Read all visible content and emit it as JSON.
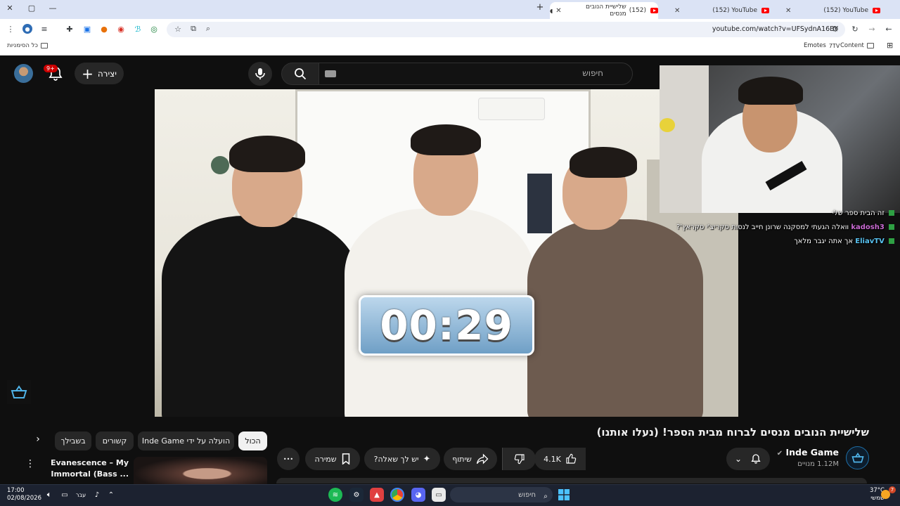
{
  "browser": {
    "tabs": [
      {
        "title": "שלישיית הנובים מנסים",
        "count_prefix": "(152)",
        "active": true
      },
      {
        "title": "(152) YouTube",
        "active": false
      },
      {
        "title": "(152) YouTube",
        "active": false
      }
    ],
    "new_tab": "+",
    "url": "youtube.com/watch?v=UFSydnA16BY",
    "bookmarks": {
      "all_bookmarks": "כל הסימניות",
      "emotes": "Emotes",
      "content": "Content"
    }
  },
  "youtube": {
    "search_placeholder": "חיפוש",
    "create_label": "יצירה",
    "notification_count": "9+",
    "video": {
      "timer": "00:29",
      "title": "שלישיית הנובים מנסים לברוח מבית הספר! (נעלו אותנו)",
      "channel_name": "Inde Game",
      "subscribers": "1.12M מנויים",
      "likes": "4.1K",
      "share_label": "שיתוף",
      "ask_label": "יש לך שאלה?",
      "save_label": "שמירה",
      "more": "•••"
    },
    "chat": [
      {
        "user": "",
        "message": "זה הבית ספר שלי"
      },
      {
        "user": "kadosh3",
        "message": "וואלה הגעתי למסקנה שרונן חייב לנסות סקריצ'י סקראץ'?"
      },
      {
        "user": "EliavTV",
        "message": "אך אתה יגבר מלאך"
      }
    ],
    "chips": {
      "all": "הכול",
      "uploaded_by": "הועלה על ידי Inde Game",
      "related": "קשורים",
      "for_you": "בשבילך"
    },
    "recommendation": {
      "title_line1": "Evanescence – My",
      "title_line2": "Immortal (Bass ..."
    }
  },
  "taskbar": {
    "search": "חיפוש",
    "time": "17:00",
    "date": "02/08/2026",
    "language": "עבר",
    "temperature": "37°C",
    "weather": "שמשי",
    "weather_badge": "7"
  },
  "colors": {
    "yt_bg": "#0f0f0f",
    "chip_bg": "#272727",
    "yt_red": "#ff0000",
    "tab_strip": "#dbe3f5"
  }
}
